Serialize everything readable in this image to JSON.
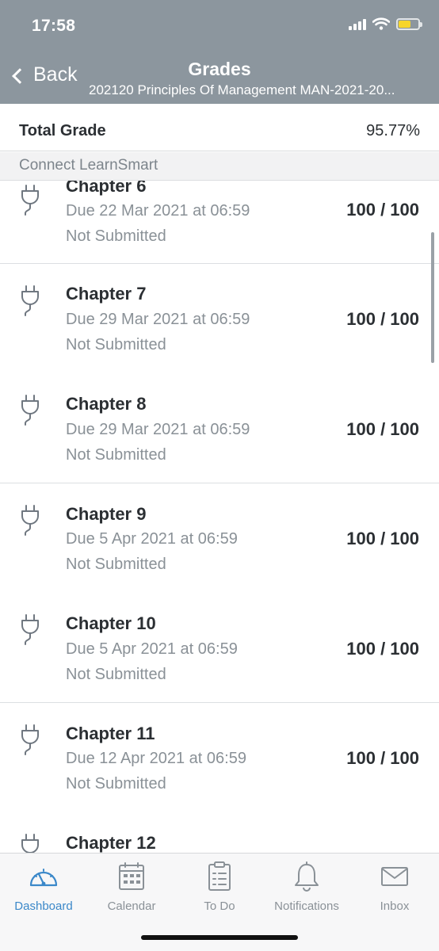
{
  "status_bar": {
    "time": "17:58"
  },
  "nav": {
    "back_label": "Back",
    "title": "Grades",
    "subtitle": "202120 Principles Of Management MAN-2021-20..."
  },
  "total": {
    "label": "Total Grade",
    "value": "95.77%"
  },
  "section": {
    "label": "Connect LearnSmart"
  },
  "items": [
    {
      "title": "Chapter 6",
      "due": "Due 22 Mar 2021 at 06:59",
      "status": "Not Submitted",
      "score": "100 / 100",
      "icon": "plug-icon"
    },
    {
      "title": "Chapter 7",
      "due": "Due 29 Mar 2021 at 06:59",
      "status": "Not Submitted",
      "score": "100 / 100",
      "icon": "plug-icon"
    },
    {
      "title": "Chapter 8",
      "due": "Due 29 Mar 2021 at 06:59",
      "status": "Not Submitted",
      "score": "100 / 100",
      "icon": "plug-icon"
    },
    {
      "title": "Chapter 9",
      "due": "Due 5 Apr 2021 at 06:59",
      "status": "Not Submitted",
      "score": "100 / 100",
      "icon": "plug-icon"
    },
    {
      "title": "Chapter 10",
      "due": "Due 5 Apr 2021 at 06:59",
      "status": "Not Submitted",
      "score": "100 / 100",
      "icon": "plug-icon"
    },
    {
      "title": "Chapter 11",
      "due": "Due 12 Apr 2021 at 06:59",
      "status": "Not Submitted",
      "score": "100 / 100",
      "icon": "plug-icon"
    },
    {
      "title": "Chapter 12",
      "icon": "plug-icon"
    }
  ],
  "tabs": [
    {
      "label": "Dashboard",
      "icon": "dashboard-gauge-icon",
      "active": true
    },
    {
      "label": "Calendar",
      "icon": "calendar-icon",
      "active": false
    },
    {
      "label": "To Do",
      "icon": "clipboard-icon",
      "active": false
    },
    {
      "label": "Notifications",
      "icon": "bell-icon",
      "active": false
    },
    {
      "label": "Inbox",
      "icon": "envelope-icon",
      "active": false
    }
  ],
  "colors": {
    "header_bg": "#8c969e",
    "accent": "#3b88c9",
    "battery": "#f6d52b",
    "muted_text": "#8a9197"
  }
}
